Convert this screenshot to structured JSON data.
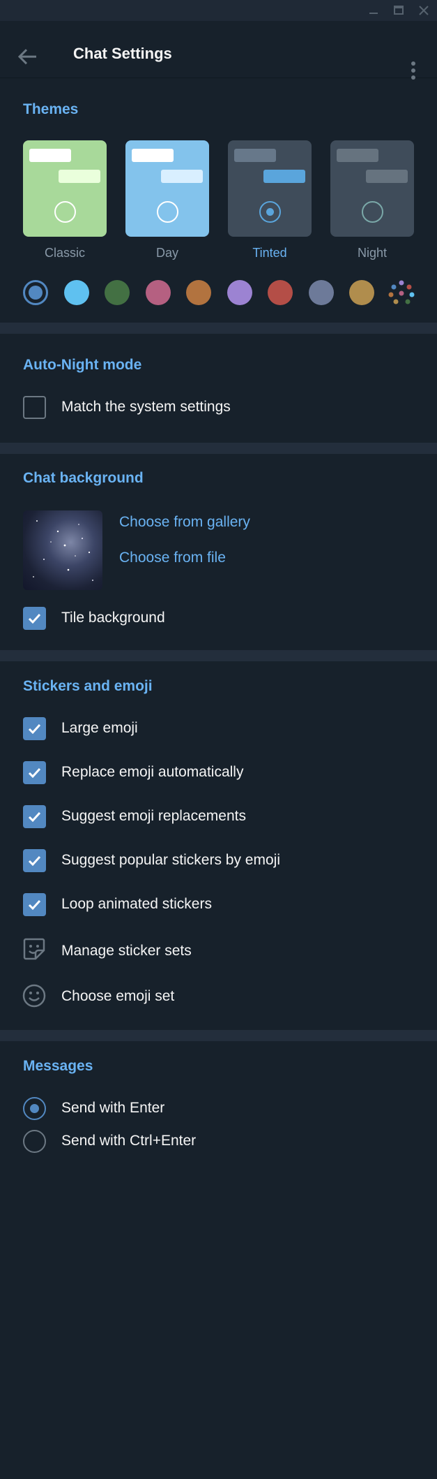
{
  "window": {
    "controls": [
      "minimize-icon",
      "maximize-icon",
      "close-icon"
    ]
  },
  "header": {
    "title": "Chat Settings",
    "back_icon": "arrow-left-icon",
    "menu_icon": "more-vertical-icon"
  },
  "themes": {
    "section_title": "Themes",
    "items": [
      {
        "label": "Classic",
        "bg": "#a8d99a",
        "bubble_in": "#ffffff",
        "bubble_out": "#eaffdc",
        "radio": "#ffffff",
        "selected": false
      },
      {
        "label": "Day",
        "bg": "#83c3ec",
        "bubble_in": "#ffffff",
        "bubble_out": "#d9efff",
        "radio": "#ffffff",
        "selected": false
      },
      {
        "label": "Tinted",
        "bg": "#3f4c5a",
        "bubble_in": "#67788a",
        "bubble_out": "#5aa5dc",
        "radio": "#5aa5dc",
        "selected": true
      },
      {
        "label": "Night",
        "bg": "#3f4c5a",
        "bubble_in": "#66737f",
        "bubble_out": "#66737f",
        "radio": "#7aa8a8",
        "selected": false
      }
    ],
    "accent_colors": [
      "#5288c1",
      "#5fc1f0",
      "#437043",
      "#b56081",
      "#b2733f",
      "#9c83d2",
      "#b44e47",
      "#6d7a99",
      "#b08d4d"
    ],
    "accent_selected": 0,
    "custom_color_icon": "palette-dots-icon"
  },
  "auto_night": {
    "section_title": "Auto-Night mode",
    "match_system": {
      "label": "Match the system settings",
      "checked": false
    }
  },
  "chat_background": {
    "section_title": "Chat background",
    "choose_gallery": "Choose from gallery",
    "choose_file": "Choose from file",
    "tile": {
      "label": "Tile background",
      "checked": true
    }
  },
  "stickers": {
    "section_title": "Stickers and emoji",
    "options": [
      {
        "label": "Large emoji",
        "checked": true
      },
      {
        "label": "Replace emoji automatically",
        "checked": true
      },
      {
        "label": "Suggest emoji replacements",
        "checked": true
      },
      {
        "label": "Suggest popular stickers by emoji",
        "checked": true
      },
      {
        "label": "Loop animated stickers",
        "checked": true
      }
    ],
    "manage_sets": {
      "label": "Manage sticker sets",
      "icon": "sticker-icon"
    },
    "emoji_set": {
      "label": "Choose emoji set",
      "icon": "smile-icon"
    }
  },
  "messages": {
    "section_title": "Messages",
    "options": [
      {
        "label": "Send with Enter",
        "selected": true
      },
      {
        "label": "Send with Ctrl+Enter",
        "selected": false
      }
    ]
  },
  "colors": {
    "accent": "#6ab3f3",
    "background": "#17212b",
    "separator": "#232e3c",
    "check": "#5288c1"
  }
}
